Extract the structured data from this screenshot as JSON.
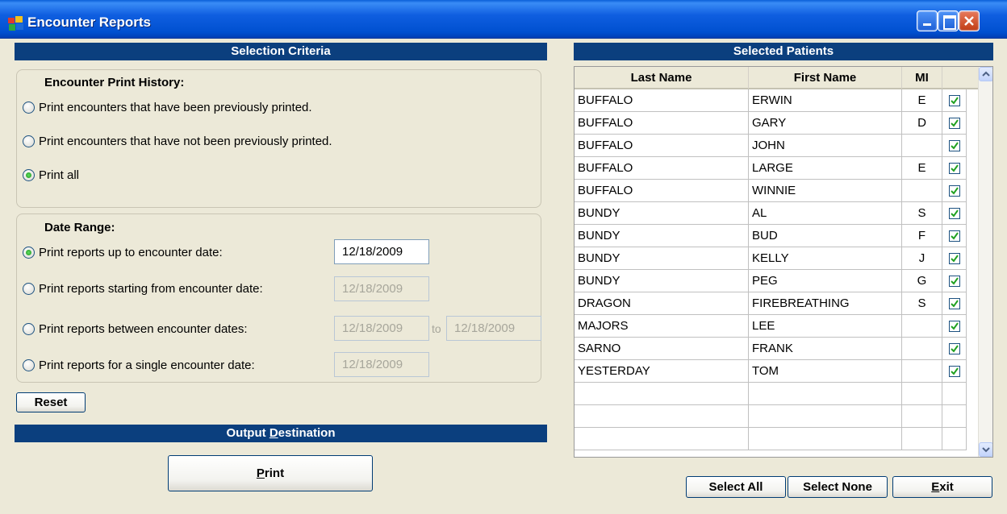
{
  "window": {
    "title": "Encounter Reports"
  },
  "selection": {
    "header": "Selection Criteria",
    "print_history": {
      "title": "Encounter Print History:",
      "options": [
        {
          "label": "Print encounters that have been previously printed.",
          "selected": false
        },
        {
          "label": "Print encounters that have  not been previously printed.",
          "selected": false
        },
        {
          "label": "Print all",
          "selected": true
        }
      ]
    },
    "date_range": {
      "title": "Date Range:",
      "options": [
        {
          "label": "Print reports up to encounter date:",
          "selected": true,
          "date": "12/18/2009"
        },
        {
          "label": "Print reports starting from encounter date:",
          "selected": false,
          "date": "12/18/2009"
        },
        {
          "label": "Print reports between encounter dates:",
          "selected": false,
          "date": "12/18/2009",
          "to_label": "to",
          "date2": "12/18/2009"
        },
        {
          "label": "Print reports for a single encounter date:",
          "selected": false,
          "date": "12/18/2009"
        }
      ]
    },
    "reset_label": "Reset"
  },
  "output": {
    "header_prefix": "Output ",
    "header_accel": "D",
    "header_suffix": "estination",
    "print_accel": "P",
    "print_rest": "rint"
  },
  "patients": {
    "header": "Selected Patients",
    "columns": [
      "Last Name",
      "First Name",
      "MI"
    ],
    "rows": [
      {
        "last": "BUFFALO",
        "first": "ERWIN",
        "mi": "E",
        "checked": true
      },
      {
        "last": "BUFFALO",
        "first": "GARY",
        "mi": "D",
        "checked": true
      },
      {
        "last": "BUFFALO",
        "first": "JOHN",
        "mi": "",
        "checked": true
      },
      {
        "last": "BUFFALO",
        "first": "LARGE",
        "mi": "E",
        "checked": true
      },
      {
        "last": "BUFFALO",
        "first": "WINNIE",
        "mi": "",
        "checked": true
      },
      {
        "last": "BUNDY",
        "first": "AL",
        "mi": "S",
        "checked": true
      },
      {
        "last": "BUNDY",
        "first": "BUD",
        "mi": "F",
        "checked": true
      },
      {
        "last": "BUNDY",
        "first": "KELLY",
        "mi": "J",
        "checked": true
      },
      {
        "last": "BUNDY",
        "first": "PEG",
        "mi": "G",
        "checked": true
      },
      {
        "last": "DRAGON",
        "first": "FIREBREATHING",
        "mi": "S",
        "checked": true
      },
      {
        "last": "MAJORS",
        "first": "LEE",
        "mi": "",
        "checked": true
      },
      {
        "last": "SARNO",
        "first": "FRANK",
        "mi": "",
        "checked": true
      },
      {
        "last": "YESTERDAY",
        "first": "TOM",
        "mi": "",
        "checked": true
      }
    ],
    "empty_rows": 3
  },
  "actions": {
    "select_all": "Select All",
    "select_none": "Select None",
    "exit_accel": "E",
    "exit_rest": "xit"
  },
  "colors": {
    "header_bg": "#0b3f7e",
    "window_bg": "#ece9d8",
    "titlebar": "#0050d0"
  }
}
